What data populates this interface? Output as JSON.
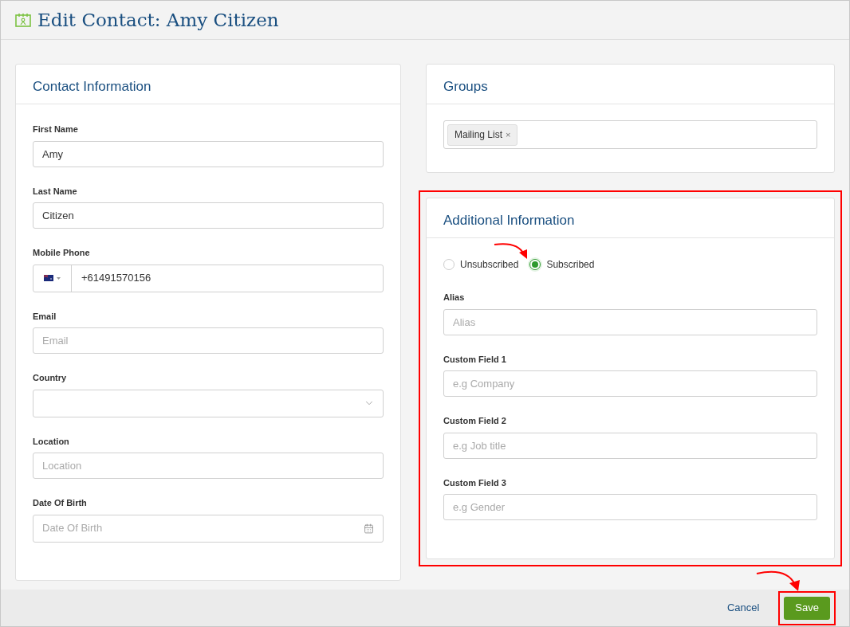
{
  "header": {
    "title": "Edit Contact: Amy Citizen"
  },
  "contact_information": {
    "title": "Contact Information",
    "fields": [
      {
        "kind": "text",
        "label": "First Name",
        "value": "Amy"
      },
      {
        "kind": "text",
        "label": "Last Name",
        "value": "Citizen"
      },
      {
        "kind": "phone",
        "label": "Mobile Phone",
        "value": "+61491570156"
      },
      {
        "kind": "text",
        "label": "Email",
        "placeholder": "Email"
      },
      {
        "kind": "select",
        "label": "Country"
      },
      {
        "kind": "text",
        "label": "Location",
        "placeholder": "Location"
      },
      {
        "kind": "date",
        "label": "Date Of Birth",
        "placeholder": "Date Of Birth"
      }
    ]
  },
  "groups": {
    "title": "Groups",
    "tags": [
      {
        "label": "Mailing List",
        "remove": "×"
      }
    ]
  },
  "additional_information": {
    "title": "Additional Information",
    "highlighted": true,
    "subscription": [
      {
        "label": "Unsubscribed",
        "selected": false
      },
      {
        "label": "Subscribed",
        "selected": true
      }
    ],
    "fields": [
      {
        "label": "Alias",
        "placeholder": "Alias"
      },
      {
        "label": "Custom Field 1",
        "placeholder": "e.g Company"
      },
      {
        "label": "Custom Field 2",
        "placeholder": "e.g Job title"
      },
      {
        "label": "Custom Field 3",
        "placeholder": "e.g Gender"
      }
    ]
  },
  "footer": {
    "cancel": "Cancel",
    "save": {
      "label": "Save",
      "highlighted": true
    }
  }
}
